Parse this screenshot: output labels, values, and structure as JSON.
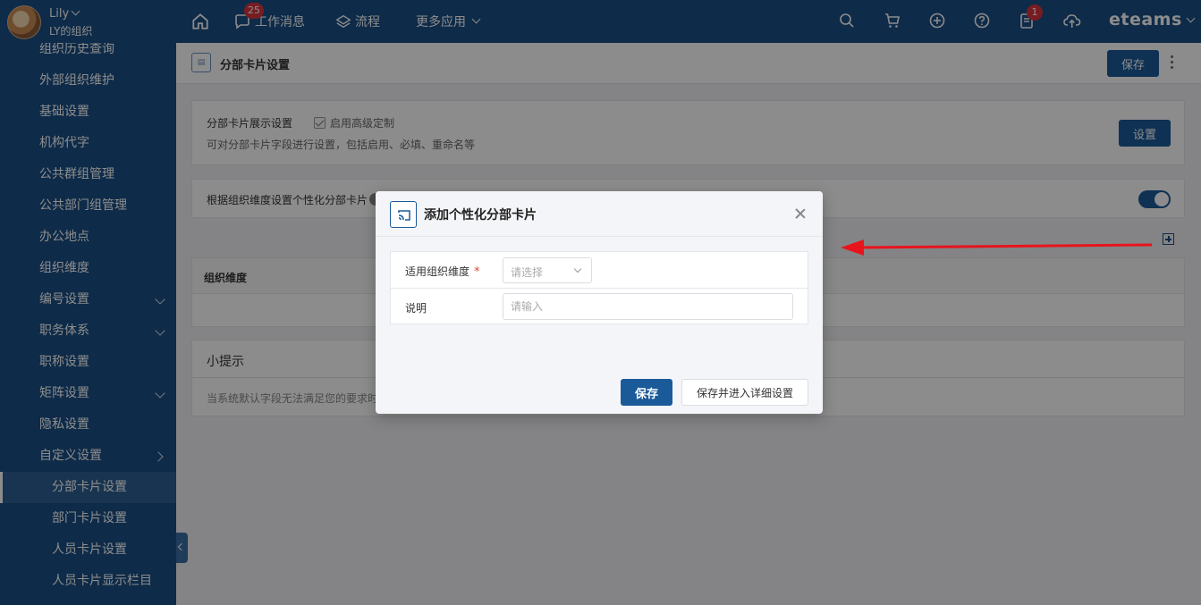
{
  "header": {
    "user_name": "Lily",
    "org_name": "LY的组织",
    "nav": {
      "messages_label": "工作消息",
      "messages_badge": "25",
      "flow_label": "流程",
      "more_label": "更多应用"
    },
    "tools": {
      "tasks_badge": "1"
    },
    "brand": "eteams"
  },
  "sidebar": {
    "items": [
      {
        "label": "组织历史查询"
      },
      {
        "label": "外部组织维护"
      },
      {
        "label": "基础设置"
      },
      {
        "label": "机构代字"
      },
      {
        "label": "公共群组管理"
      },
      {
        "label": "公共部门组管理"
      },
      {
        "label": "办公地点"
      },
      {
        "label": "组织维度"
      },
      {
        "label": "编号设置"
      },
      {
        "label": "职务体系"
      },
      {
        "label": "职称设置"
      },
      {
        "label": "矩阵设置"
      },
      {
        "label": "隐私设置"
      },
      {
        "label": "自定义设置"
      },
      {
        "label": "分部卡片设置"
      },
      {
        "label": "部门卡片设置"
      },
      {
        "label": "人员卡片设置"
      },
      {
        "label": "人员卡片显示栏目"
      }
    ]
  },
  "page": {
    "title": "分部卡片设置",
    "save_label": "保存",
    "display_card": {
      "title": "分部卡片展示设置",
      "checkbox_label": "启用高级定制",
      "description": "可对分部卡片字段进行设置，包括启用、必填、重命名等",
      "button_label": "设置"
    },
    "dimension_card": {
      "title": "根据组织维度设置个性化分部卡片"
    },
    "table": {
      "header": "组织维度"
    },
    "tips": {
      "title": "小提示",
      "text": "当系统默认字段无法满足您的要求时"
    }
  },
  "modal": {
    "title": "添加个性化分部卡片",
    "fields": {
      "dimension_label": "适用组织维度",
      "required_mark": "*",
      "dimension_placeholder": "请选择",
      "note_label": "说明",
      "note_placeholder": "请输入"
    },
    "save_label": "保存",
    "save_detail_label": "保存并进入详细设置"
  },
  "colors": {
    "brand": "#1b4f86",
    "primary_button": "#1b5a99",
    "annotation_arrow": "#e8141c",
    "required": "#e8472f"
  }
}
